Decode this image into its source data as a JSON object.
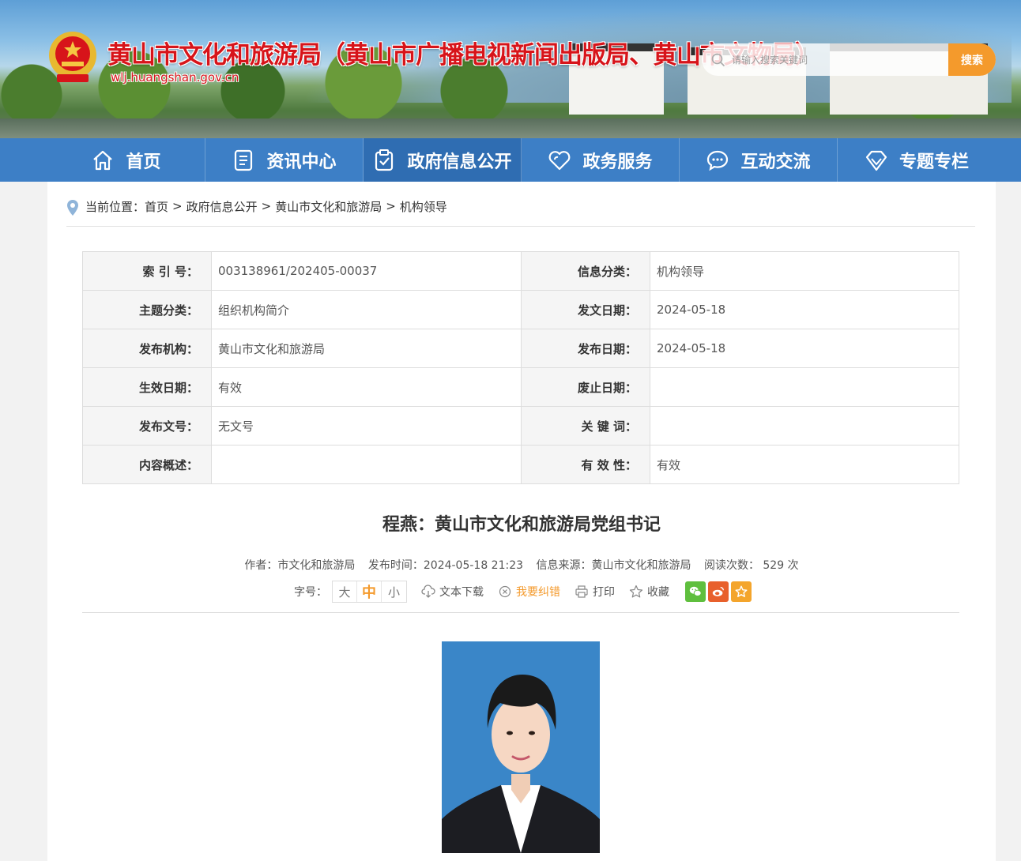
{
  "header": {
    "title": "黄山市文化和旅游局（黄山市广播电视新闻出版局、黄山市文物局）",
    "domain": "wlj.huangshan.gov.cn",
    "search_placeholder": "请输入搜索关键词",
    "search_button": "搜索"
  },
  "nav": [
    {
      "label": "首页",
      "icon": "home-icon"
    },
    {
      "label": "资讯中心",
      "icon": "document-icon"
    },
    {
      "label": "政府信息公开",
      "icon": "clipboard-check-icon",
      "active": true
    },
    {
      "label": "政务服务",
      "icon": "heart-icon"
    },
    {
      "label": "互动交流",
      "icon": "chat-icon"
    },
    {
      "label": "专题专栏",
      "icon": "diamond-icon"
    }
  ],
  "breadcrumb": {
    "prefix": "当前位置：",
    "items": [
      "首页",
      "政府信息公开",
      "黄山市文化和旅游局",
      "机构领导"
    ],
    "separator": ">"
  },
  "meta_table": [
    [
      {
        "k": "索 引 号：",
        "v": "003138961/202405-00037"
      },
      {
        "k": "信息分类：",
        "v": "机构领导"
      }
    ],
    [
      {
        "k": "主题分类：",
        "v": "组织机构简介"
      },
      {
        "k": "发文日期：",
        "v": "2024-05-18"
      }
    ],
    [
      {
        "k": "发布机构：",
        "v": "黄山市文化和旅游局"
      },
      {
        "k": "发布日期：",
        "v": "2024-05-18"
      }
    ],
    [
      {
        "k": "生效日期：",
        "v": "有效"
      },
      {
        "k": "废止日期：",
        "v": ""
      }
    ],
    [
      {
        "k": "发布文号：",
        "v": "无文号"
      },
      {
        "k": "关 键 词：",
        "v": ""
      }
    ],
    [
      {
        "k": "内容概述：",
        "v": ""
      },
      {
        "k": "有 效 性：",
        "v": "有效"
      }
    ]
  ],
  "article": {
    "title": "程燕：黄山市文化和旅游局党组书记",
    "author": "作者：市文化和旅游局",
    "publish_time": "发布时间：2024-05-18 21:23",
    "source": "信息来源：黄山市文化和旅游局",
    "views": "阅读次数： 529 次"
  },
  "tools": {
    "font_label": "字号：",
    "font_sizes": [
      "大",
      "中",
      "小"
    ],
    "font_active": "中",
    "download": "文本下载",
    "report": "我要纠错",
    "print": "打印",
    "favorite": "收藏",
    "share": [
      "wechat-icon",
      "weibo-icon",
      "star-icon"
    ]
  },
  "colors": {
    "nav_bg": "#3d7fc6",
    "nav_active": "#2f6db2",
    "accent_orange": "#f49a2c",
    "title_red": "#d7141a",
    "wechat": "#5fbf3e",
    "weibo": "#e8602c",
    "favorite_star": "#f4a52c"
  }
}
